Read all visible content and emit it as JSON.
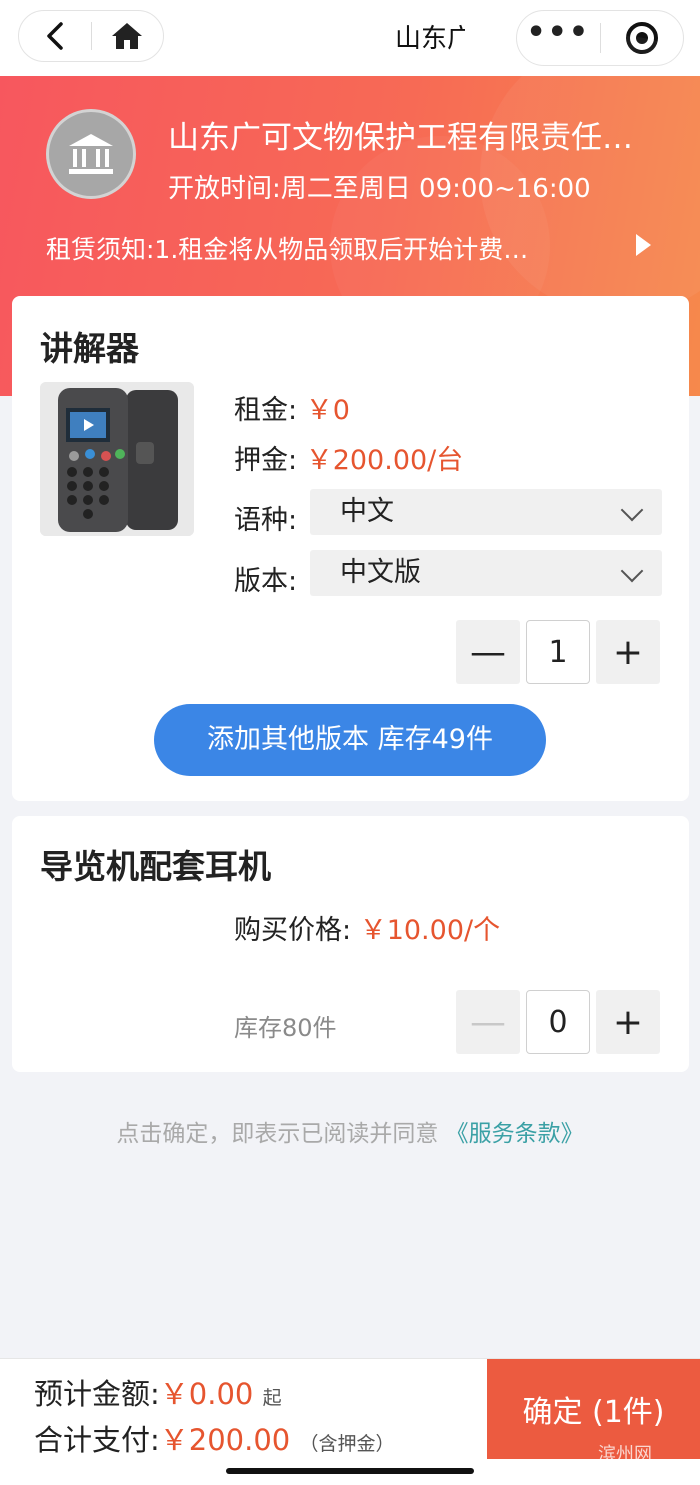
{
  "nav": {
    "title": "山东广",
    "back_icon": "chevron-left-icon",
    "home_icon": "home-icon",
    "more_icon": "more-dots-icon",
    "close_icon": "target-icon"
  },
  "header": {
    "org_name": "山东广可文物保护工程有限责任公司",
    "open_hours": "开放时间:周二至周日 09:00~16:00",
    "notice": "租赁须知:1.租金将从物品领取后开始计费…",
    "accent_gradient": [
      "#f7575e",
      "#f6894c"
    ]
  },
  "card1": {
    "title": "讲解器",
    "rent_label": "租金:",
    "rent_value": "￥0",
    "deposit_label": "押金:",
    "deposit_value": "￥200.00/台",
    "lang_label": "语种:",
    "lang_value": "中文",
    "version_label": "版本:",
    "version_value": "中文版",
    "quantity": "1",
    "minus": "—",
    "plus": "+",
    "add_button": "添加其他版本 库存49件"
  },
  "card2": {
    "title": "导览机配套耳机",
    "price_label": "购买价格:",
    "price_value": "￥10.00/个",
    "stock": "库存80件",
    "quantity": "0",
    "minus": "—",
    "plus": "+"
  },
  "agreement": {
    "text": "点击确定，即表示已阅读并同意",
    "link": "《服务条款》"
  },
  "footer": {
    "estimate_label": "预计金额:",
    "estimate_value": "￥0.00",
    "estimate_suffix": "起",
    "total_label": "合计支付:",
    "total_value": "￥200.00",
    "total_suffix": "（含押金）",
    "confirm": "确定 (1件)"
  },
  "watermark": "滨州网",
  "colors": {
    "price": "#e6552f",
    "primary_button": "#3b86e6",
    "confirm_button": "#ec5b40",
    "link": "#3aa0a5"
  }
}
